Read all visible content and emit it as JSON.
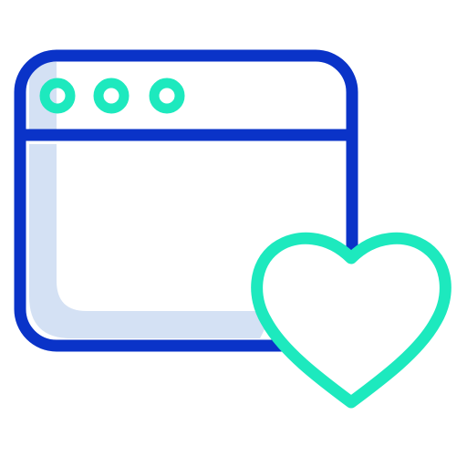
{
  "icon": {
    "semantic": "browser-window-favorite-icon",
    "parts": [
      "browser-window-icon",
      "window-control-dots",
      "heart-icon"
    ],
    "window_control_count": 3
  },
  "colors": {
    "background": "#ffffff",
    "window_outline": "#0a33c8",
    "window_shade": "#d4e1f4",
    "accent": "#1de9be"
  }
}
